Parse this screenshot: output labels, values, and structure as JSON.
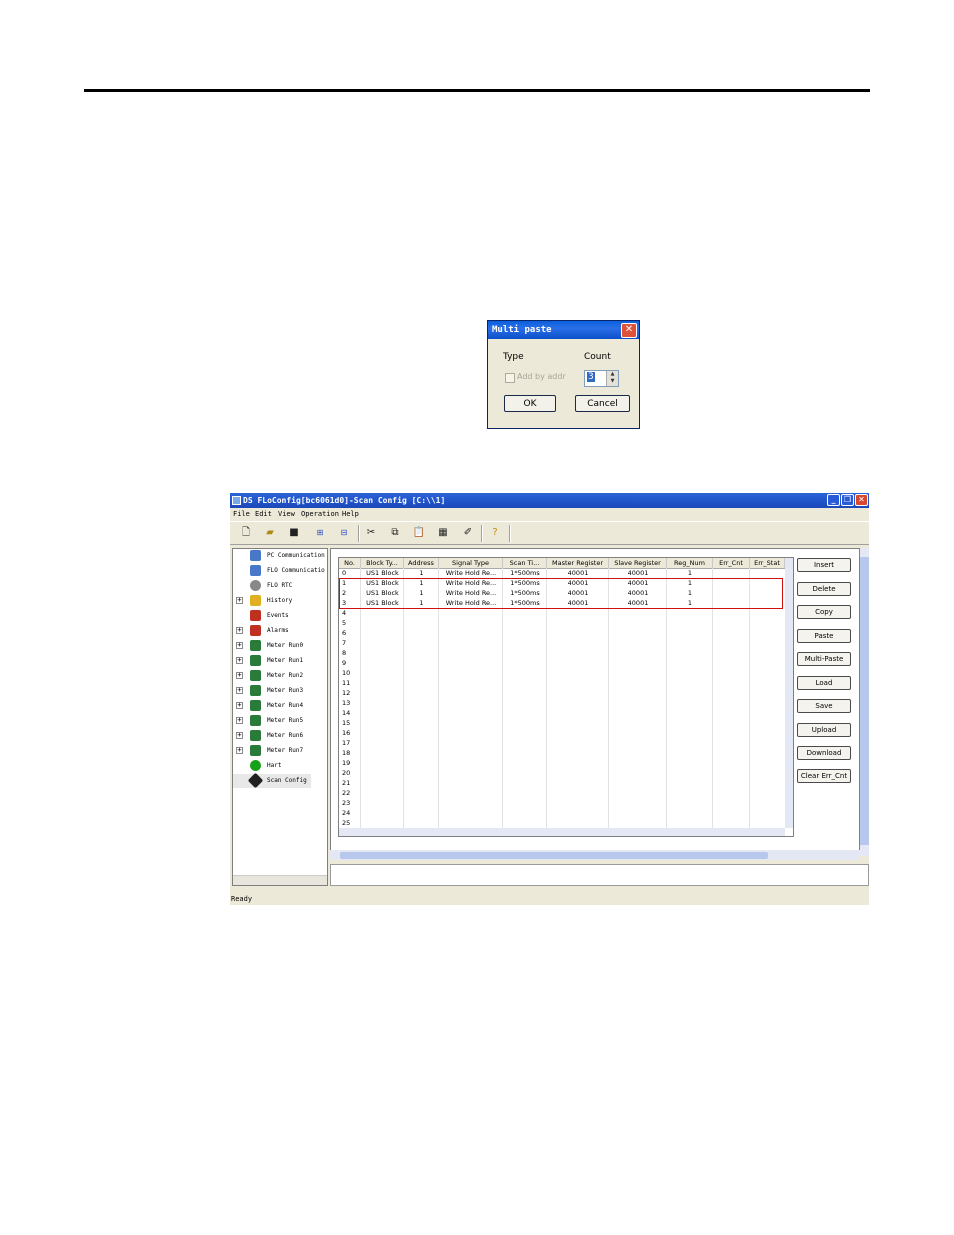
{
  "dialog": {
    "title": "Multi paste",
    "close": "✕",
    "type_label": "Type",
    "count_label": "Count",
    "checkbox_label": "Add by addr",
    "count_value": "3",
    "ok_label": "OK",
    "cancel_label": "Cancel"
  },
  "app": {
    "title": "DS FLoConfig[bc6061d0]-Scan Config [C:\\\\1]",
    "menu": [
      "File",
      "Edit",
      "View",
      "Operation",
      "Help"
    ],
    "toolbar_icons": [
      "new-icon",
      "open-icon",
      "save-icon",
      "connect-icon",
      "disconnect-icon",
      "cut-icon",
      "copy-icon",
      "paste-icon",
      "multi-paste-icon",
      "eraser-icon",
      "help-icon"
    ],
    "tree": [
      {
        "label": "PC Communication",
        "expandable": false,
        "icon_color": "#4a78c8"
      },
      {
        "label": "FLO Communicatio",
        "expandable": false,
        "icon_color": "#4a78c8"
      },
      {
        "label": "FLO RTC",
        "expandable": false,
        "icon_color": "#888888"
      },
      {
        "label": "History",
        "expandable": true,
        "icon_color": "#e0b020"
      },
      {
        "label": "Events",
        "expandable": false,
        "icon_color": "#c03020"
      },
      {
        "label": "Alarms",
        "expandable": true,
        "icon_color": "#c03020"
      },
      {
        "label": "Meter Run0",
        "expandable": true,
        "icon_color": "#2a7a3a"
      },
      {
        "label": "Meter Run1",
        "expandable": true,
        "icon_color": "#2a7a3a"
      },
      {
        "label": "Meter Run2",
        "expandable": true,
        "icon_color": "#2a7a3a"
      },
      {
        "label": "Meter Run3",
        "expandable": true,
        "icon_color": "#2a7a3a"
      },
      {
        "label": "Meter Run4",
        "expandable": true,
        "icon_color": "#2a7a3a"
      },
      {
        "label": "Meter Run5",
        "expandable": true,
        "icon_color": "#2a7a3a"
      },
      {
        "label": "Meter Run6",
        "expandable": true,
        "icon_color": "#2a7a3a"
      },
      {
        "label": "Meter Run7",
        "expandable": true,
        "icon_color": "#2a7a3a"
      },
      {
        "label": "Hart",
        "expandable": false,
        "icon_color": "#18a018"
      },
      {
        "label": "Scan Config",
        "expandable": false,
        "icon_color": "#202020"
      }
    ],
    "grid_columns": [
      "No.",
      "Block Ty...",
      "Address",
      "Signal Type",
      "Scan Ti...",
      "Master Register",
      "Slave Register",
      "Reg_Num",
      "Err_Cnt",
      "Err_Stat"
    ],
    "grid_rows": [
      [
        "0",
        "US1 Block",
        "1",
        "Write Hold Re...",
        "1*500ms",
        "40001",
        "40001",
        "1",
        "",
        ""
      ],
      [
        "1",
        "US1 Block",
        "1",
        "Write Hold Re...",
        "1*500ms",
        "40001",
        "40001",
        "1",
        "",
        ""
      ],
      [
        "2",
        "US1 Block",
        "1",
        "Write Hold Re...",
        "1*500ms",
        "40001",
        "40001",
        "1",
        "",
        ""
      ],
      [
        "3",
        "US1 Block",
        "1",
        "Write Hold Re...",
        "1*500ms",
        "40001",
        "40001",
        "1",
        "",
        ""
      ],
      [
        "4"
      ],
      [
        "5"
      ],
      [
        "6"
      ],
      [
        "7"
      ],
      [
        "8"
      ],
      [
        "9"
      ],
      [
        "10"
      ],
      [
        "11"
      ],
      [
        "12"
      ],
      [
        "13"
      ],
      [
        "14"
      ],
      [
        "15"
      ],
      [
        "16"
      ],
      [
        "17"
      ],
      [
        "18"
      ],
      [
        "19"
      ],
      [
        "20"
      ],
      [
        "21"
      ],
      [
        "22"
      ],
      [
        "23"
      ],
      [
        "24"
      ],
      [
        "25"
      ]
    ],
    "side_buttons": [
      "Insert",
      "Delete",
      "Copy",
      "Paste",
      "Multi-Paste",
      "Load",
      "Save",
      "Upload",
      "Download",
      "Clear Err_Cnt"
    ],
    "status": "Ready"
  }
}
